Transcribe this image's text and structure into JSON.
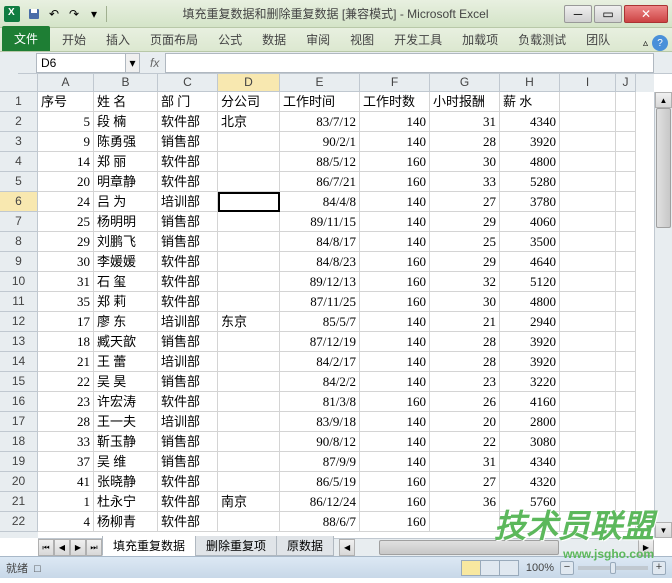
{
  "window": {
    "title": "填充重复数据和删除重复数据 [兼容模式] - Microsoft Excel"
  },
  "ribbon": {
    "file": "文件",
    "tabs": [
      "开始",
      "插入",
      "页面布局",
      "公式",
      "数据",
      "审阅",
      "视图",
      "开发工具",
      "加载项",
      "负载测试",
      "团队"
    ]
  },
  "namebox": {
    "value": "D6"
  },
  "formula": {
    "value": ""
  },
  "columns": [
    "A",
    "B",
    "C",
    "D",
    "E",
    "F",
    "G",
    "H",
    "I",
    "J"
  ],
  "headers": [
    "序号",
    "姓 名",
    "部 门",
    "分公司",
    "工作时间",
    "工作时数",
    "小时报酬",
    "薪 水"
  ],
  "rows": [
    {
      "n": 2,
      "a": "5",
      "b": "段 楠",
      "c": "软件部",
      "d": "北京",
      "e": "83/7/12",
      "f": "140",
      "g": "31",
      "h": "4340"
    },
    {
      "n": 3,
      "a": "9",
      "b": "陈勇强",
      "c": "销售部",
      "d": "",
      "e": "90/2/1",
      "f": "140",
      "g": "28",
      "h": "3920"
    },
    {
      "n": 4,
      "a": "14",
      "b": "郑 丽",
      "c": "软件部",
      "d": "",
      "e": "88/5/12",
      "f": "160",
      "g": "30",
      "h": "4800"
    },
    {
      "n": 5,
      "a": "20",
      "b": "明章静",
      "c": "软件部",
      "d": "",
      "e": "86/7/21",
      "f": "160",
      "g": "33",
      "h": "5280"
    },
    {
      "n": 6,
      "a": "24",
      "b": "吕 为",
      "c": "培训部",
      "d": "",
      "e": "84/4/8",
      "f": "140",
      "g": "27",
      "h": "3780"
    },
    {
      "n": 7,
      "a": "25",
      "b": "杨明明",
      "c": "销售部",
      "d": "",
      "e": "89/11/15",
      "f": "140",
      "g": "29",
      "h": "4060"
    },
    {
      "n": 8,
      "a": "29",
      "b": "刘鹏飞",
      "c": "销售部",
      "d": "",
      "e": "84/8/17",
      "f": "140",
      "g": "25",
      "h": "3500"
    },
    {
      "n": 9,
      "a": "30",
      "b": "李媛媛",
      "c": "软件部",
      "d": "",
      "e": "84/8/23",
      "f": "160",
      "g": "29",
      "h": "4640"
    },
    {
      "n": 10,
      "a": "31",
      "b": "石 玺",
      "c": "软件部",
      "d": "",
      "e": "89/12/13",
      "f": "160",
      "g": "32",
      "h": "5120"
    },
    {
      "n": 11,
      "a": "35",
      "b": "郑 莉",
      "c": "软件部",
      "d": "",
      "e": "87/11/25",
      "f": "160",
      "g": "30",
      "h": "4800"
    },
    {
      "n": 12,
      "a": "17",
      "b": "廖 东",
      "c": "培训部",
      "d": "东京",
      "e": "85/5/7",
      "f": "140",
      "g": "21",
      "h": "2940"
    },
    {
      "n": 13,
      "a": "18",
      "b": "臧天歆",
      "c": "销售部",
      "d": "",
      "e": "87/12/19",
      "f": "140",
      "g": "28",
      "h": "3920"
    },
    {
      "n": 14,
      "a": "21",
      "b": "王 蕾",
      "c": "培训部",
      "d": "",
      "e": "84/2/17",
      "f": "140",
      "g": "28",
      "h": "3920"
    },
    {
      "n": 15,
      "a": "22",
      "b": "吴 昊",
      "c": "销售部",
      "d": "",
      "e": "84/2/2",
      "f": "140",
      "g": "23",
      "h": "3220"
    },
    {
      "n": 16,
      "a": "23",
      "b": "许宏涛",
      "c": "软件部",
      "d": "",
      "e": "81/3/8",
      "f": "160",
      "g": "26",
      "h": "4160"
    },
    {
      "n": 17,
      "a": "28",
      "b": "王一夫",
      "c": "培训部",
      "d": "",
      "e": "83/9/18",
      "f": "140",
      "g": "20",
      "h": "2800"
    },
    {
      "n": 18,
      "a": "33",
      "b": "靳玉静",
      "c": "销售部",
      "d": "",
      "e": "90/8/12",
      "f": "140",
      "g": "22",
      "h": "3080"
    },
    {
      "n": 19,
      "a": "37",
      "b": "吴 维",
      "c": "销售部",
      "d": "",
      "e": "87/9/9",
      "f": "140",
      "g": "31",
      "h": "4340"
    },
    {
      "n": 20,
      "a": "41",
      "b": "张晓静",
      "c": "软件部",
      "d": "",
      "e": "86/5/19",
      "f": "160",
      "g": "27",
      "h": "4320"
    },
    {
      "n": 21,
      "a": "1",
      "b": "杜永宁",
      "c": "软件部",
      "d": "南京",
      "e": "86/12/24",
      "f": "160",
      "g": "36",
      "h": "5760"
    },
    {
      "n": 22,
      "a": "4",
      "b": "杨柳青",
      "c": "软件部",
      "d": "",
      "e": "88/6/7",
      "f": "160",
      "g": "",
      "h": ""
    }
  ],
  "sheets": {
    "tabs": [
      "填充重复数据",
      "删除重复项",
      "原数据"
    ],
    "active": 0
  },
  "status": {
    "ready": "就绪",
    "rec": "□",
    "zoom": "100%",
    "minus": "−",
    "plus": "+"
  },
  "selected": {
    "row": 6,
    "col": "D"
  },
  "watermark": {
    "main": "技术员联盟",
    "sub": "www.jsgho.com"
  }
}
